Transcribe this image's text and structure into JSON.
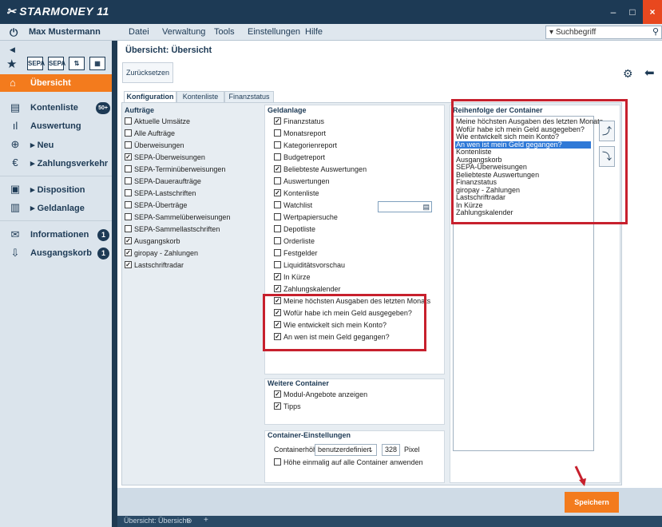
{
  "app": {
    "logo_text": "STARMONEY 11",
    "logo_mark": "✂"
  },
  "window": {
    "minimize": "–",
    "maximize": "□",
    "close": "×"
  },
  "topbar": {
    "user": "Max Mustermann",
    "menu": [
      "Datei",
      "Verwaltung",
      "Tools",
      "Einstellungen",
      "Hilfe"
    ],
    "search_placeholder": "Suchbegriff",
    "search_prefix": "▾"
  },
  "sidebar": {
    "quick_icons": [
      "SEPA",
      "SEPA",
      "⇅",
      "▦"
    ],
    "active": "Übersicht",
    "items": [
      {
        "label": "Kontenliste",
        "icon": "▤",
        "badge": "50+"
      },
      {
        "label": "Auswertung",
        "icon": "ıl"
      },
      {
        "label": "▸ Neu",
        "icon": "⊕"
      },
      {
        "label": "▸ Zahlungsverkehr",
        "icon": "€"
      },
      {
        "label": "▸ Disposition",
        "icon": "▣"
      },
      {
        "label": "▸ Geldanlage",
        "icon": "▥"
      },
      {
        "label": "Informationen",
        "icon": "✉",
        "badge": "1"
      },
      {
        "label": "Ausgangskorb",
        "icon": "⇩",
        "badge": "1"
      }
    ]
  },
  "main": {
    "title": "Übersicht: Übersicht",
    "reset_label": "Zurücksetzen",
    "tabs": [
      "Konfiguration",
      "Kontenliste",
      "Finanzstatus"
    ]
  },
  "auftraege": {
    "title": "Aufträge",
    "items": [
      {
        "label": "Aktuelle Umsätze",
        "checked": false
      },
      {
        "label": "Alle Aufträge",
        "checked": false
      },
      {
        "label": "Überweisungen",
        "checked": false
      },
      {
        "label": "SEPA-Überweisungen",
        "checked": true
      },
      {
        "label": "SEPA-Terminüberweisungen",
        "checked": false
      },
      {
        "label": "SEPA-Daueraufträge",
        "checked": false
      },
      {
        "label": "SEPA-Lastschriften",
        "checked": false
      },
      {
        "label": "SEPA-Überträge",
        "checked": false
      },
      {
        "label": "SEPA-Sammelüberweisungen",
        "checked": false
      },
      {
        "label": "SEPA-Sammellastschriften",
        "checked": false
      },
      {
        "label": "Ausgangskorb",
        "checked": true
      },
      {
        "label": "giropay - Zahlungen",
        "checked": true
      },
      {
        "label": "Lastschriftradar",
        "checked": true
      }
    ]
  },
  "geldanlage": {
    "title": "Geldanlage",
    "items": [
      {
        "label": "Finanzstatus",
        "checked": true
      },
      {
        "label": "Monatsreport",
        "checked": false
      },
      {
        "label": "Kategorienreport",
        "checked": false
      },
      {
        "label": "Budgetreport",
        "checked": false
      },
      {
        "label": "Beliebteste Auswertungen",
        "checked": true
      },
      {
        "label": "Auswertungen",
        "checked": false
      },
      {
        "label": "Kontenliste",
        "checked": true
      },
      {
        "label": "Watchlist",
        "checked": false
      },
      {
        "label": "Wertpapiersuche",
        "checked": false
      },
      {
        "label": "Depotliste",
        "checked": false
      },
      {
        "label": "Orderliste",
        "checked": false
      },
      {
        "label": "Festgelder",
        "checked": false
      },
      {
        "label": "Liquiditätsvorschau",
        "checked": false
      },
      {
        "label": "In Kürze",
        "checked": true
      },
      {
        "label": "Zahlungskalender",
        "checked": true
      },
      {
        "label": "Meine höchsten Ausgaben des letzten Monats",
        "checked": true
      },
      {
        "label": "Wofür habe ich mein Geld ausgegeben?",
        "checked": true
      },
      {
        "label": "Wie entwickelt sich mein Konto?",
        "checked": true
      },
      {
        "label": "An wen ist mein Geld gegangen?",
        "checked": true
      }
    ]
  },
  "weitere": {
    "title": "Weitere Container",
    "items": [
      {
        "label": "Modul-Angebote anzeigen",
        "checked": true
      },
      {
        "label": "Tipps",
        "checked": true
      }
    ]
  },
  "container_settings": {
    "title": "Container-Einstellungen",
    "height_label": "Containerhöhe",
    "height_mode": "benutzerdefiniert",
    "height_value": "328",
    "unit": "Pixel",
    "apply_all_label": "Höhe einmalig auf alle Container anwenden",
    "apply_all_checked": false
  },
  "order": {
    "title": "Reihenfolge der Container",
    "items": [
      "Meine höchsten Ausgaben des letzten Monats",
      "Wofür habe ich mein Geld ausgegeben?",
      "Wie entwickelt sich mein Konto?",
      "An wen ist mein Geld gegangen?",
      "Kontenliste",
      "Ausgangskorb",
      "SEPA-Überweisungen",
      "Beliebteste Auswertungen",
      "Finanzstatus",
      "giropay - Zahlungen",
      "Lastschriftradar",
      "In Kürze",
      "Zahlungskalender"
    ],
    "selected_index": 3
  },
  "save_label": "Speichern",
  "status": {
    "doc_tab": "Übersicht: Übersicht",
    "add": "+"
  },
  "colors": {
    "accent": "#f37b1d",
    "navy": "#1d3a55",
    "highlight": "#c7202d",
    "selection": "#2f79d7"
  }
}
